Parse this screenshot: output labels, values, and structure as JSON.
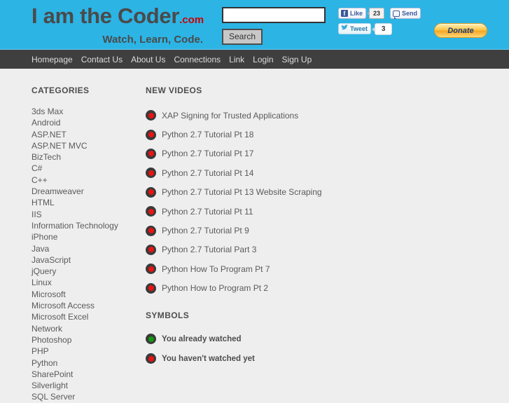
{
  "site": {
    "logo_main": "I am the Coder",
    "logo_suffix": ".com",
    "tagline": "Watch, Learn, Code."
  },
  "search": {
    "value": "",
    "placeholder": "",
    "button_label": "Search"
  },
  "social": {
    "facebook_like_label": "Like",
    "facebook_like_count": "23",
    "facebook_glyph": "f",
    "facebook_send_label": "Send",
    "twitter_label": "Tweet",
    "twitter_count": "3",
    "twitter_glyph": "ᵕ",
    "donate_label": "Donate"
  },
  "nav": {
    "items": [
      {
        "label": "Homepage"
      },
      {
        "label": "Contact Us"
      },
      {
        "label": "About Us"
      },
      {
        "label": "Connections"
      },
      {
        "label": "Link"
      },
      {
        "label": "Login"
      },
      {
        "label": "Sign Up"
      }
    ]
  },
  "sidebar": {
    "title": "CATEGORIES",
    "items": [
      {
        "label": "3ds Max"
      },
      {
        "label": "Android"
      },
      {
        "label": "ASP.NET"
      },
      {
        "label": "ASP.NET MVC"
      },
      {
        "label": "BizTech"
      },
      {
        "label": "C#"
      },
      {
        "label": "C++"
      },
      {
        "label": "Dreamweaver"
      },
      {
        "label": "HTML"
      },
      {
        "label": "IIS"
      },
      {
        "label": "Information Technology"
      },
      {
        "label": "iPhone"
      },
      {
        "label": "Java"
      },
      {
        "label": "JavaScript"
      },
      {
        "label": "jQuery"
      },
      {
        "label": "Linux"
      },
      {
        "label": "Microsoft"
      },
      {
        "label": "Microsoft Access"
      },
      {
        "label": "Microsoft Excel"
      },
      {
        "label": "Network"
      },
      {
        "label": "Photoshop"
      },
      {
        "label": "PHP"
      },
      {
        "label": "Python"
      },
      {
        "label": "SharePoint"
      },
      {
        "label": "Silverlight"
      },
      {
        "label": "SQL Server"
      }
    ]
  },
  "main": {
    "videos_title": "NEW VIDEOS",
    "videos": [
      {
        "label": "XAP Signing for Trusted Applications",
        "status": "unwatched"
      },
      {
        "label": "Python 2.7 Tutorial Pt 18",
        "status": "unwatched"
      },
      {
        "label": "Python 2.7 Tutorial Pt 17",
        "status": "unwatched"
      },
      {
        "label": "Python 2.7 Tutorial Pt 14",
        "status": "unwatched"
      },
      {
        "label": "Python 2.7 Tutorial Pt 13 Website Scraping",
        "status": "unwatched"
      },
      {
        "label": "Python 2.7 Tutorial Pt 11",
        "status": "unwatched"
      },
      {
        "label": "Python 2.7 Tutorial Pt 9",
        "status": "unwatched"
      },
      {
        "label": "Python 2.7 Tutorial Part 3",
        "status": "unwatched"
      },
      {
        "label": "Python How To Program Pt 7",
        "status": "unwatched"
      },
      {
        "label": "Python How to Program Pt 2",
        "status": "unwatched"
      }
    ],
    "symbols_title": "SYMBOLS",
    "symbols": [
      {
        "label": "You already watched",
        "status": "watched"
      },
      {
        "label": "You haven't watched yet",
        "status": "unwatched"
      }
    ]
  },
  "colors": {
    "header_bg": "#2cb4e5",
    "nav_bg": "#3f3f3f",
    "page_bg": "#eeeeee",
    "accent_red": "#e81313",
    "accent_green": "#119911",
    "logo_red": "#cc0000"
  }
}
